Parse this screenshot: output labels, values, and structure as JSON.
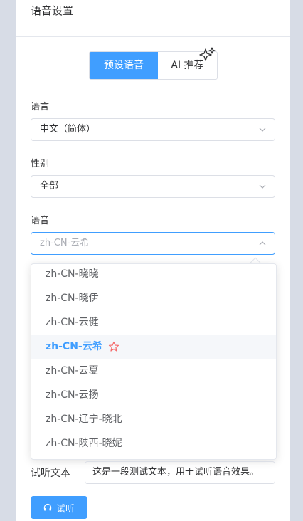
{
  "panel": {
    "title": "语音设置"
  },
  "tabs": {
    "preset": "预设语音",
    "ai": "AI 推荐"
  },
  "language": {
    "label": "语言",
    "value": "中文（简体）"
  },
  "gender": {
    "label": "性别",
    "value": "全部"
  },
  "voice": {
    "label": "语音",
    "value": "zh-CN-云希",
    "options": [
      "zh-CN-晓晓",
      "zh-CN-晓伊",
      "zh-CN-云健",
      "zh-CN-云希",
      "zh-CN-云夏",
      "zh-CN-云扬",
      "zh-CN-辽宁-晓北",
      "zh-CN-陕西-晓妮"
    ],
    "selected_index": 3
  },
  "sample": {
    "label": "试听文本",
    "value": "这是一段测试文本，用于试听语音效果。",
    "button": "试听"
  },
  "colors": {
    "accent": "#409eff",
    "recommend_star": "#f56c6c",
    "background": "#d7dce6"
  },
  "icons": {
    "ai_tab": "sparkle-icon",
    "select_caret": "chevron-down-icon",
    "open_caret": "chevron-up-icon",
    "recommended": "star-icon",
    "play": "headset-icon"
  }
}
